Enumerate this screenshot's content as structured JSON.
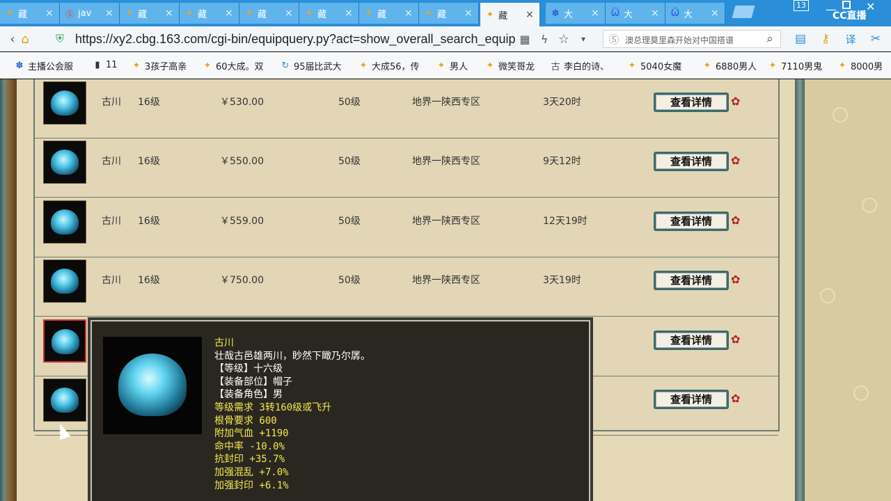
{
  "tabs": [
    {
      "label": "藏",
      "icon": "game-tab-icon"
    },
    {
      "label": "jav",
      "icon": "sogou-icon"
    },
    {
      "label": "藏",
      "icon": "game-tab-icon"
    },
    {
      "label": "藏",
      "icon": "game-tab-icon"
    },
    {
      "label": "藏",
      "icon": "game-tab-icon"
    },
    {
      "label": "藏",
      "icon": "game-tab-icon"
    },
    {
      "label": "藏",
      "icon": "game-tab-icon"
    },
    {
      "label": "藏",
      "icon": "game-tab-icon"
    },
    {
      "label": "藏",
      "icon": "game-tab-icon",
      "active": true
    },
    {
      "label": "大",
      "icon": "baidu-paw-icon"
    },
    {
      "label": "大",
      "icon": "game-wing-icon"
    },
    {
      "label": "大",
      "icon": "game-wing-icon"
    }
  ],
  "tab_count": "13",
  "close_glyph": "×",
  "cc_logo": "CC直播",
  "address": {
    "url": "https://xy2.cbg.163.com/cgi-bin/equipquery.py?act=show_overall_search_equip",
    "search_text": "澳总理莫里森开始对中国搭谱"
  },
  "bookmarks": [
    {
      "label": "主播公会服",
      "icon": "baidu-paw-icon"
    },
    {
      "label": "11",
      "icon": "film-icon"
    },
    {
      "label": "3孩子高亲",
      "icon": "game-tab-icon"
    },
    {
      "label": "60大成。双",
      "icon": "game-tab-icon"
    },
    {
      "label": "95届比武大",
      "icon": "refresh-icon"
    },
    {
      "label": "大成56，传",
      "icon": "game-tab-icon"
    },
    {
      "label": "男人",
      "icon": "game-tab-icon"
    },
    {
      "label": "微笑哥龙",
      "icon": "game-tab-icon"
    },
    {
      "label": "李白的诗、",
      "icon": "poem-icon"
    },
    {
      "label": "5040女魔",
      "icon": "game-tab-icon"
    },
    {
      "label": "6880男人",
      "icon": "game-tab-icon"
    },
    {
      "label": "7110男鬼",
      "icon": "game-tab-icon"
    },
    {
      "label": "8000男",
      "icon": "game-tab-icon"
    }
  ],
  "listing": {
    "button_label": "查看详情",
    "rows": [
      {
        "name": "古川",
        "level": "16级",
        "price": "￥530.00",
        "req_level": "50级",
        "server": "地界一陕西专区",
        "time_left": "3天20时"
      },
      {
        "name": "古川",
        "level": "16级",
        "price": "￥550.00",
        "req_level": "50级",
        "server": "地界一陕西专区",
        "time_left": "9天12时"
      },
      {
        "name": "古川",
        "level": "16级",
        "price": "￥559.00",
        "req_level": "50级",
        "server": "地界一陕西专区",
        "time_left": "12天19时"
      },
      {
        "name": "古川",
        "level": "16级",
        "price": "￥750.00",
        "req_level": "50级",
        "server": "地界一陕西专区",
        "time_left": "3天19时"
      },
      {
        "name": "",
        "level": "",
        "price": "",
        "req_level": "",
        "server": "",
        "time_left": ""
      },
      {
        "name": "",
        "level": "",
        "price": "",
        "req_level": "",
        "server": "",
        "time_left": ""
      }
    ]
  },
  "tooltip": {
    "name": "古川",
    "description": "壮哉古邑雄两川，眇然下瞰乃尔孱。",
    "lines_white": [
      "【等级】十六级",
      "【装备部位】帽子",
      "【装备角色】男"
    ],
    "lines_yellow": [
      "等级需求 3转160级或飞升",
      "根骨要求 600",
      "附加气血 +1190",
      "命中率 -10.0%",
      "抗封印 +35.7%",
      "加强混乱 +7.0%",
      "加强封印 +6.1%"
    ]
  }
}
